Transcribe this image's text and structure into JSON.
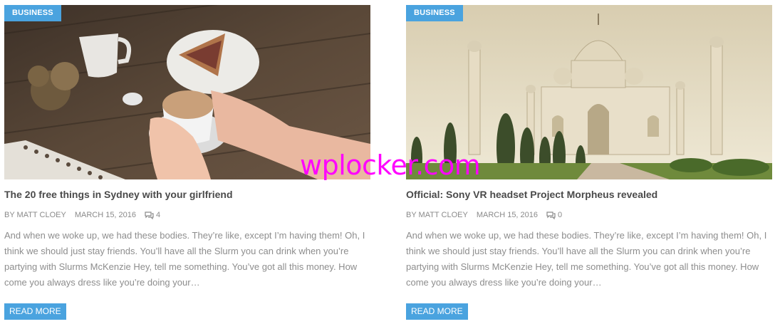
{
  "watermark": "wplocker.com",
  "colors": {
    "accent": "#4aa3df",
    "title": "#4a4a4a",
    "meta": "#8a8a8a",
    "watermark": "#ff00ff"
  },
  "posts": [
    {
      "category": "BUSINESS",
      "title": "The 20 free things in Sydney with your girlfriend",
      "author": "BY MATT CLOEY",
      "date": "MARCH 15, 2016",
      "comments": "4",
      "comment_icon": "comments-icon",
      "excerpt": "And when we woke up, we had these bodies. They’re like, except I’m having them! Oh, I think we should just stay friends. You’ll have all the Slurm you can drink when you’re partying with Slurms McKenzie Hey, tell me something. You’ve got all this money. How come you always dress like you’re doing your…",
      "read_more": "READ MORE"
    },
    {
      "category": "BUSINESS",
      "title": "Official: Sony VR headset Project Morpheus revealed",
      "author": "BY MATT CLOEY",
      "date": "MARCH 15, 2016",
      "comments": "0",
      "comment_icon": "comments-icon",
      "excerpt": "And when we woke up, we had these bodies. They’re like, except I’m having them! Oh, I think we should just stay friends. You’ll have all the Slurm you can drink when you’re partying with Slurms McKenzie Hey, tell me something. You’ve got all this money. How come you always dress like you’re doing your…",
      "read_more": "READ MORE"
    }
  ]
}
